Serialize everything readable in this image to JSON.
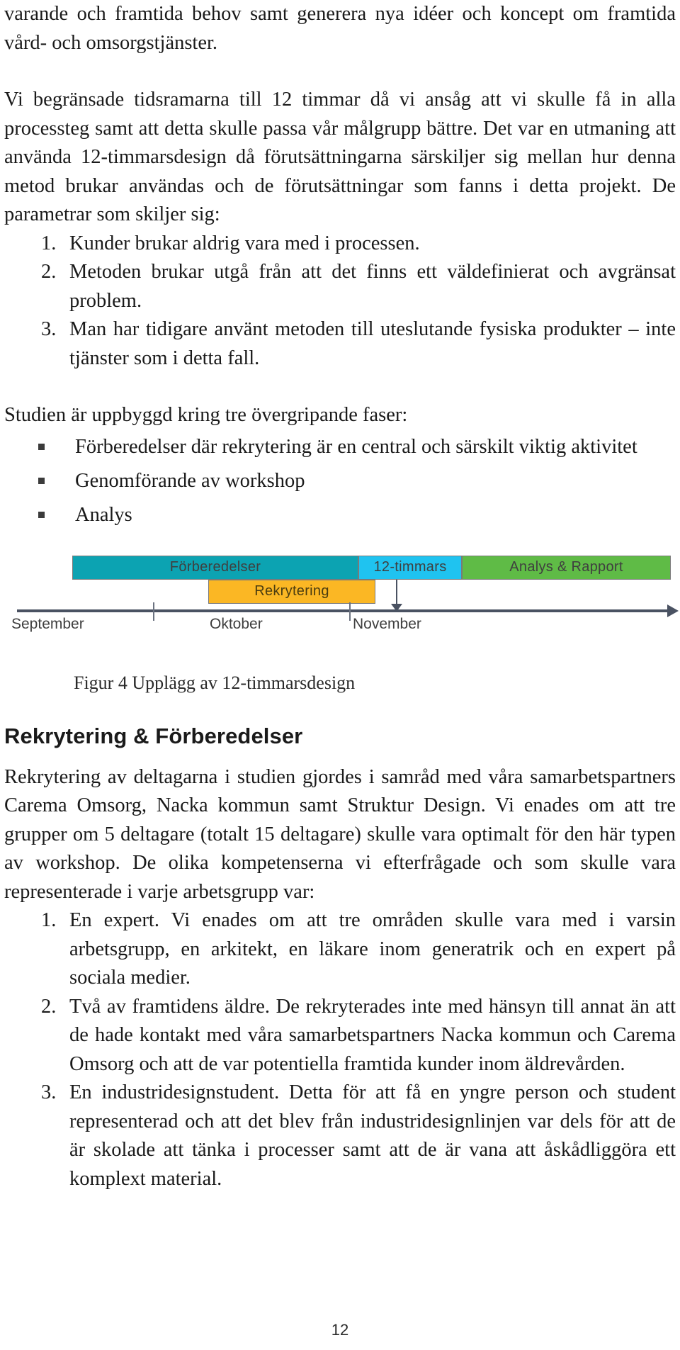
{
  "page": {
    "number": "12",
    "language": "sv"
  },
  "paragraphs": {
    "p1": "varande och framtida behov samt generera nya idéer och koncept om framtida vård- och omsorgstjänster.",
    "p2": "Vi begränsade tidsramarna till 12 timmar då vi ansåg att vi skulle få in alla processteg samt att detta skulle passa vår målgrupp bättre. Det var en utmaning att använda 12-timmarsdesign då förutsättningarna särskiljer sig mellan hur denna metod brukar användas och de förutsättningar som fanns i detta projekt. De parametrar som skiljer sig:",
    "p3_intro": "Studien är uppbyggd kring tre övergripande faser:",
    "p4": "Rekrytering av deltagarna i studien gjordes i samråd med våra samarbetspartners Carema Omsorg, Nacka kommun samt Struktur Design. Vi enades om att tre grupper om 5 deltagare (totalt 15 deltagare) skulle vara optimalt för den här typen av workshop. De olika kompetenserna vi efterfrågade och som skulle vara representerade i varje arbetsgrupp var:"
  },
  "param_list": {
    "items": [
      {
        "marker": "1.",
        "text": "Kunder brukar aldrig vara med i processen."
      },
      {
        "marker": "2.",
        "text": "Metoden brukar utgå från att det finns ett väldefinierat och avgränsat problem."
      },
      {
        "marker": "3.",
        "text": "Man har tidigare använt metoden till uteslutande fysiska produkter – inte tjänster som i detta fall."
      }
    ]
  },
  "phase_list": {
    "items": [
      {
        "text": "Förberedelser där rekrytering är en central och särskilt viktig aktivitet"
      },
      {
        "text": "Genomförande av workshop"
      },
      {
        "text": "Analys"
      }
    ]
  },
  "figure": {
    "caption": "Figur 4 Upplägg av 12-timmarsdesign",
    "bars": {
      "prep": "Förberedelser",
      "twelve": "12-timmars",
      "analys": "Analys & Rapport",
      "rekrytering": "Rekrytering"
    },
    "months": {
      "september": "September",
      "oktober": "Oktober",
      "november": "November"
    },
    "colors": {
      "prep": "#0CA3B2",
      "twelve": "#1FC3F0",
      "analys": "#5FBB46",
      "rekrytering": "#FBB724",
      "axis": "#4a5262"
    }
  },
  "section": {
    "heading": "Rekrytering & Förberedelser"
  },
  "competence_list": {
    "items": [
      {
        "marker": "1.",
        "text": "En expert. Vi enades om att tre områden skulle vara med i varsin arbetsgrupp, en arkitekt, en läkare inom generatrik och en expert på sociala medier."
      },
      {
        "marker": "2.",
        "text": "Två av framtidens äldre. De rekryterades inte med hänsyn till annat än att de hade kontakt med våra samarbetspartners Nacka kommun och Carema Omsorg och att de var potentiella framtida kunder inom äldrevården."
      },
      {
        "marker": "3.",
        "text": "En industridesignstudent. Detta för att få en yngre person och student representerad och att det blev från industridesignlinjen var dels för att de är skolade att tänka i processer samt att de är vana att åskådliggöra ett komplext material."
      }
    ]
  }
}
